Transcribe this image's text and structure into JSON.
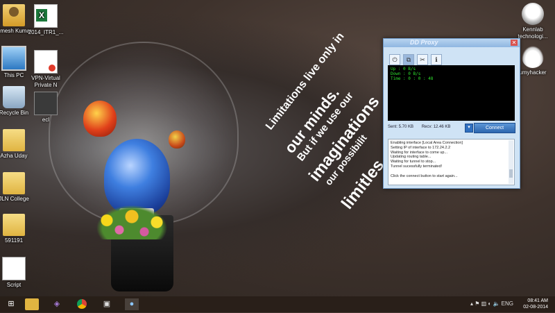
{
  "desktop": {
    "icons_left": [
      {
        "label": "Umesh Kumar",
        "icon": "user-folder-icon"
      },
      {
        "label": "This PC",
        "icon": "computer-icon"
      },
      {
        "label": "Recycle Bin",
        "icon": "recycle-bin-icon"
      },
      {
        "label": "Azha Uday",
        "icon": "folder-icon"
      },
      {
        "label": "JLN College",
        "icon": "folder-icon"
      },
      {
        "label": "591191",
        "icon": "folder-icon"
      },
      {
        "label": "Script",
        "icon": "document-icon"
      }
    ],
    "icons_second_col": [
      {
        "label": "2014_ITR1_...",
        "icon": "excel-icon"
      },
      {
        "label": "VPN-Virtual Private N",
        "icon": "vpn-shortcut-icon"
      },
      {
        "label": "ecl",
        "icon": "executable-icon"
      }
    ],
    "icons_right": [
      {
        "label": "Kennlab technologi...",
        "icon": "robot-icon"
      },
      {
        "label": "umyhacker",
        "icon": "hat-icon"
      }
    ]
  },
  "wallpaper_quote": {
    "l1": "Limitations live only in",
    "l2": "our minds.",
    "l3": "But if we use our",
    "l4": "imaginations",
    "l5": "our possibilit",
    "l6": "limitles"
  },
  "vpn_window": {
    "title": "DD Proxy",
    "toolbar": [
      "power-icon",
      "network-icon",
      "tools-icon",
      "info-icon"
    ],
    "console": {
      "up": "Up   : 0 B/s",
      "down": "Down : 0 B/s",
      "time": "Time : 0 : 0 : 48"
    },
    "sent": "Sent: 5.70 KB",
    "recv": "Recv: 12.46 KB",
    "connect_label": "Connect",
    "log_lines": [
      "Enabling interface [Local Area Connection]",
      "Setting IP of interface to 172.24.2.2",
      "Waiting for interface to come up...",
      "Updating routing table...",
      "Waiting for tunnel to stop...",
      "Tunnel sucessfully terminated!",
      "",
      "Click the connect button to start again..."
    ]
  },
  "taskbar": {
    "apps": [
      "windows-start-icon",
      "file-explorer-icon",
      "visual-studio-icon",
      "chrome-icon",
      "remote-desktop-icon",
      "vpn-app-icon"
    ],
    "time": "08:41 AM",
    "date": "02-08-2014",
    "lang": "ENG"
  },
  "colors": {
    "console_text": "#2ee02e",
    "window_bg": "#cfe3f5",
    "connect_button": "#2d66ae"
  }
}
